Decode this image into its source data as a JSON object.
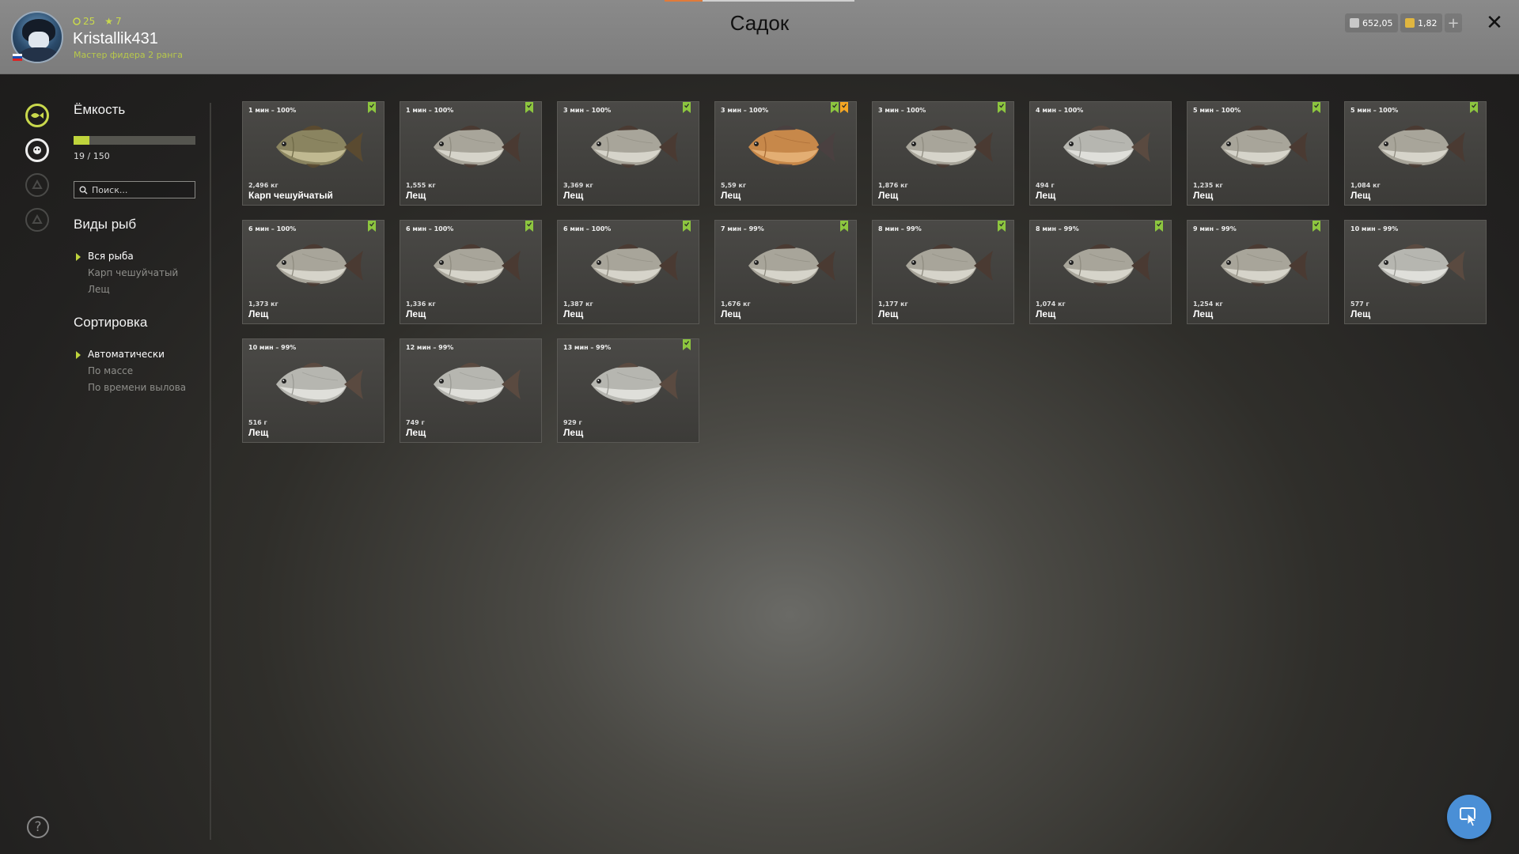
{
  "header": {
    "title": "Садок",
    "username": "Kristallik431",
    "rank": "Мастер фидера 2 ранга",
    "badge_level": "25",
    "badge_stars": "7",
    "silver": "652,05",
    "gold": "1,82",
    "plus_label": "+",
    "close_label": "✕"
  },
  "sidebar": {
    "capacity_heading": "Ёмкость",
    "capacity_text": "19 / 150",
    "capacity_fraction": 0.127,
    "search_placeholder": "Поиск...",
    "species_heading": "Виды рыб",
    "species": [
      "Вся рыба",
      "Карп чешуйчатый",
      "Лещ"
    ],
    "species_selected": 0,
    "sort_heading": "Сортировка",
    "sort_options": [
      "Автоматически",
      "По массе",
      "По времени вылова"
    ],
    "sort_selected": 0
  },
  "help_label": "?",
  "colors": {
    "accent": "#bfd43c",
    "flag_green": "#8dc63f",
    "flag_orange": "#f5a623"
  },
  "fish": [
    {
      "time": "1 мин – 100%",
      "weight": "2,496 кг",
      "name": "Карп чешуйчатый",
      "type": "carp",
      "flags": [
        "green"
      ]
    },
    {
      "time": "1 мин – 100%",
      "weight": "1,555 кг",
      "name": "Лещ",
      "type": "bream",
      "flags": [
        "green"
      ]
    },
    {
      "time": "3 мин – 100%",
      "weight": "3,369 кг",
      "name": "Лещ",
      "type": "bream",
      "flags": [
        "green"
      ]
    },
    {
      "time": "3 мин – 100%",
      "weight": "5,59 кг",
      "name": "Лещ",
      "type": "gold",
      "flags": [
        "green",
        "orange"
      ]
    },
    {
      "time": "3 мин – 100%",
      "weight": "1,876 кг",
      "name": "Лещ",
      "type": "bream",
      "flags": [
        "green"
      ]
    },
    {
      "time": "4 мин – 100%",
      "weight": "494 г",
      "name": "Лещ",
      "type": "silver",
      "flags": []
    },
    {
      "time": "5 мин – 100%",
      "weight": "1,235 кг",
      "name": "Лещ",
      "type": "bream",
      "flags": [
        "green"
      ]
    },
    {
      "time": "5 мин – 100%",
      "weight": "1,084 кг",
      "name": "Лещ",
      "type": "bream",
      "flags": [
        "green"
      ]
    },
    {
      "time": "6 мин – 100%",
      "weight": "1,373 кг",
      "name": "Лещ",
      "type": "bream",
      "flags": [
        "green"
      ]
    },
    {
      "time": "6 мин – 100%",
      "weight": "1,336 кг",
      "name": "Лещ",
      "type": "bream",
      "flags": [
        "green"
      ]
    },
    {
      "time": "6 мин – 100%",
      "weight": "1,387 кг",
      "name": "Лещ",
      "type": "bream",
      "flags": [
        "green"
      ]
    },
    {
      "time": "7 мин – 99%",
      "weight": "1,676 кг",
      "name": "Лещ",
      "type": "bream",
      "flags": [
        "green"
      ]
    },
    {
      "time": "8 мин – 99%",
      "weight": "1,177 кг",
      "name": "Лещ",
      "type": "bream",
      "flags": [
        "green"
      ]
    },
    {
      "time": "8 мин – 99%",
      "weight": "1,074 кг",
      "name": "Лещ",
      "type": "bream",
      "flags": [
        "green"
      ]
    },
    {
      "time": "9 мин – 99%",
      "weight": "1,254 кг",
      "name": "Лещ",
      "type": "bream",
      "flags": [
        "green"
      ]
    },
    {
      "time": "10 мин – 99%",
      "weight": "577 г",
      "name": "Лещ",
      "type": "silver",
      "flags": []
    },
    {
      "time": "10 мин – 99%",
      "weight": "516 г",
      "name": "Лещ",
      "type": "silver",
      "flags": []
    },
    {
      "time": "12 мин – 99%",
      "weight": "749 г",
      "name": "Лещ",
      "type": "silver",
      "flags": []
    },
    {
      "time": "13 мин – 99%",
      "weight": "929 г",
      "name": "Лещ",
      "type": "silver",
      "flags": [
        "green"
      ]
    }
  ]
}
